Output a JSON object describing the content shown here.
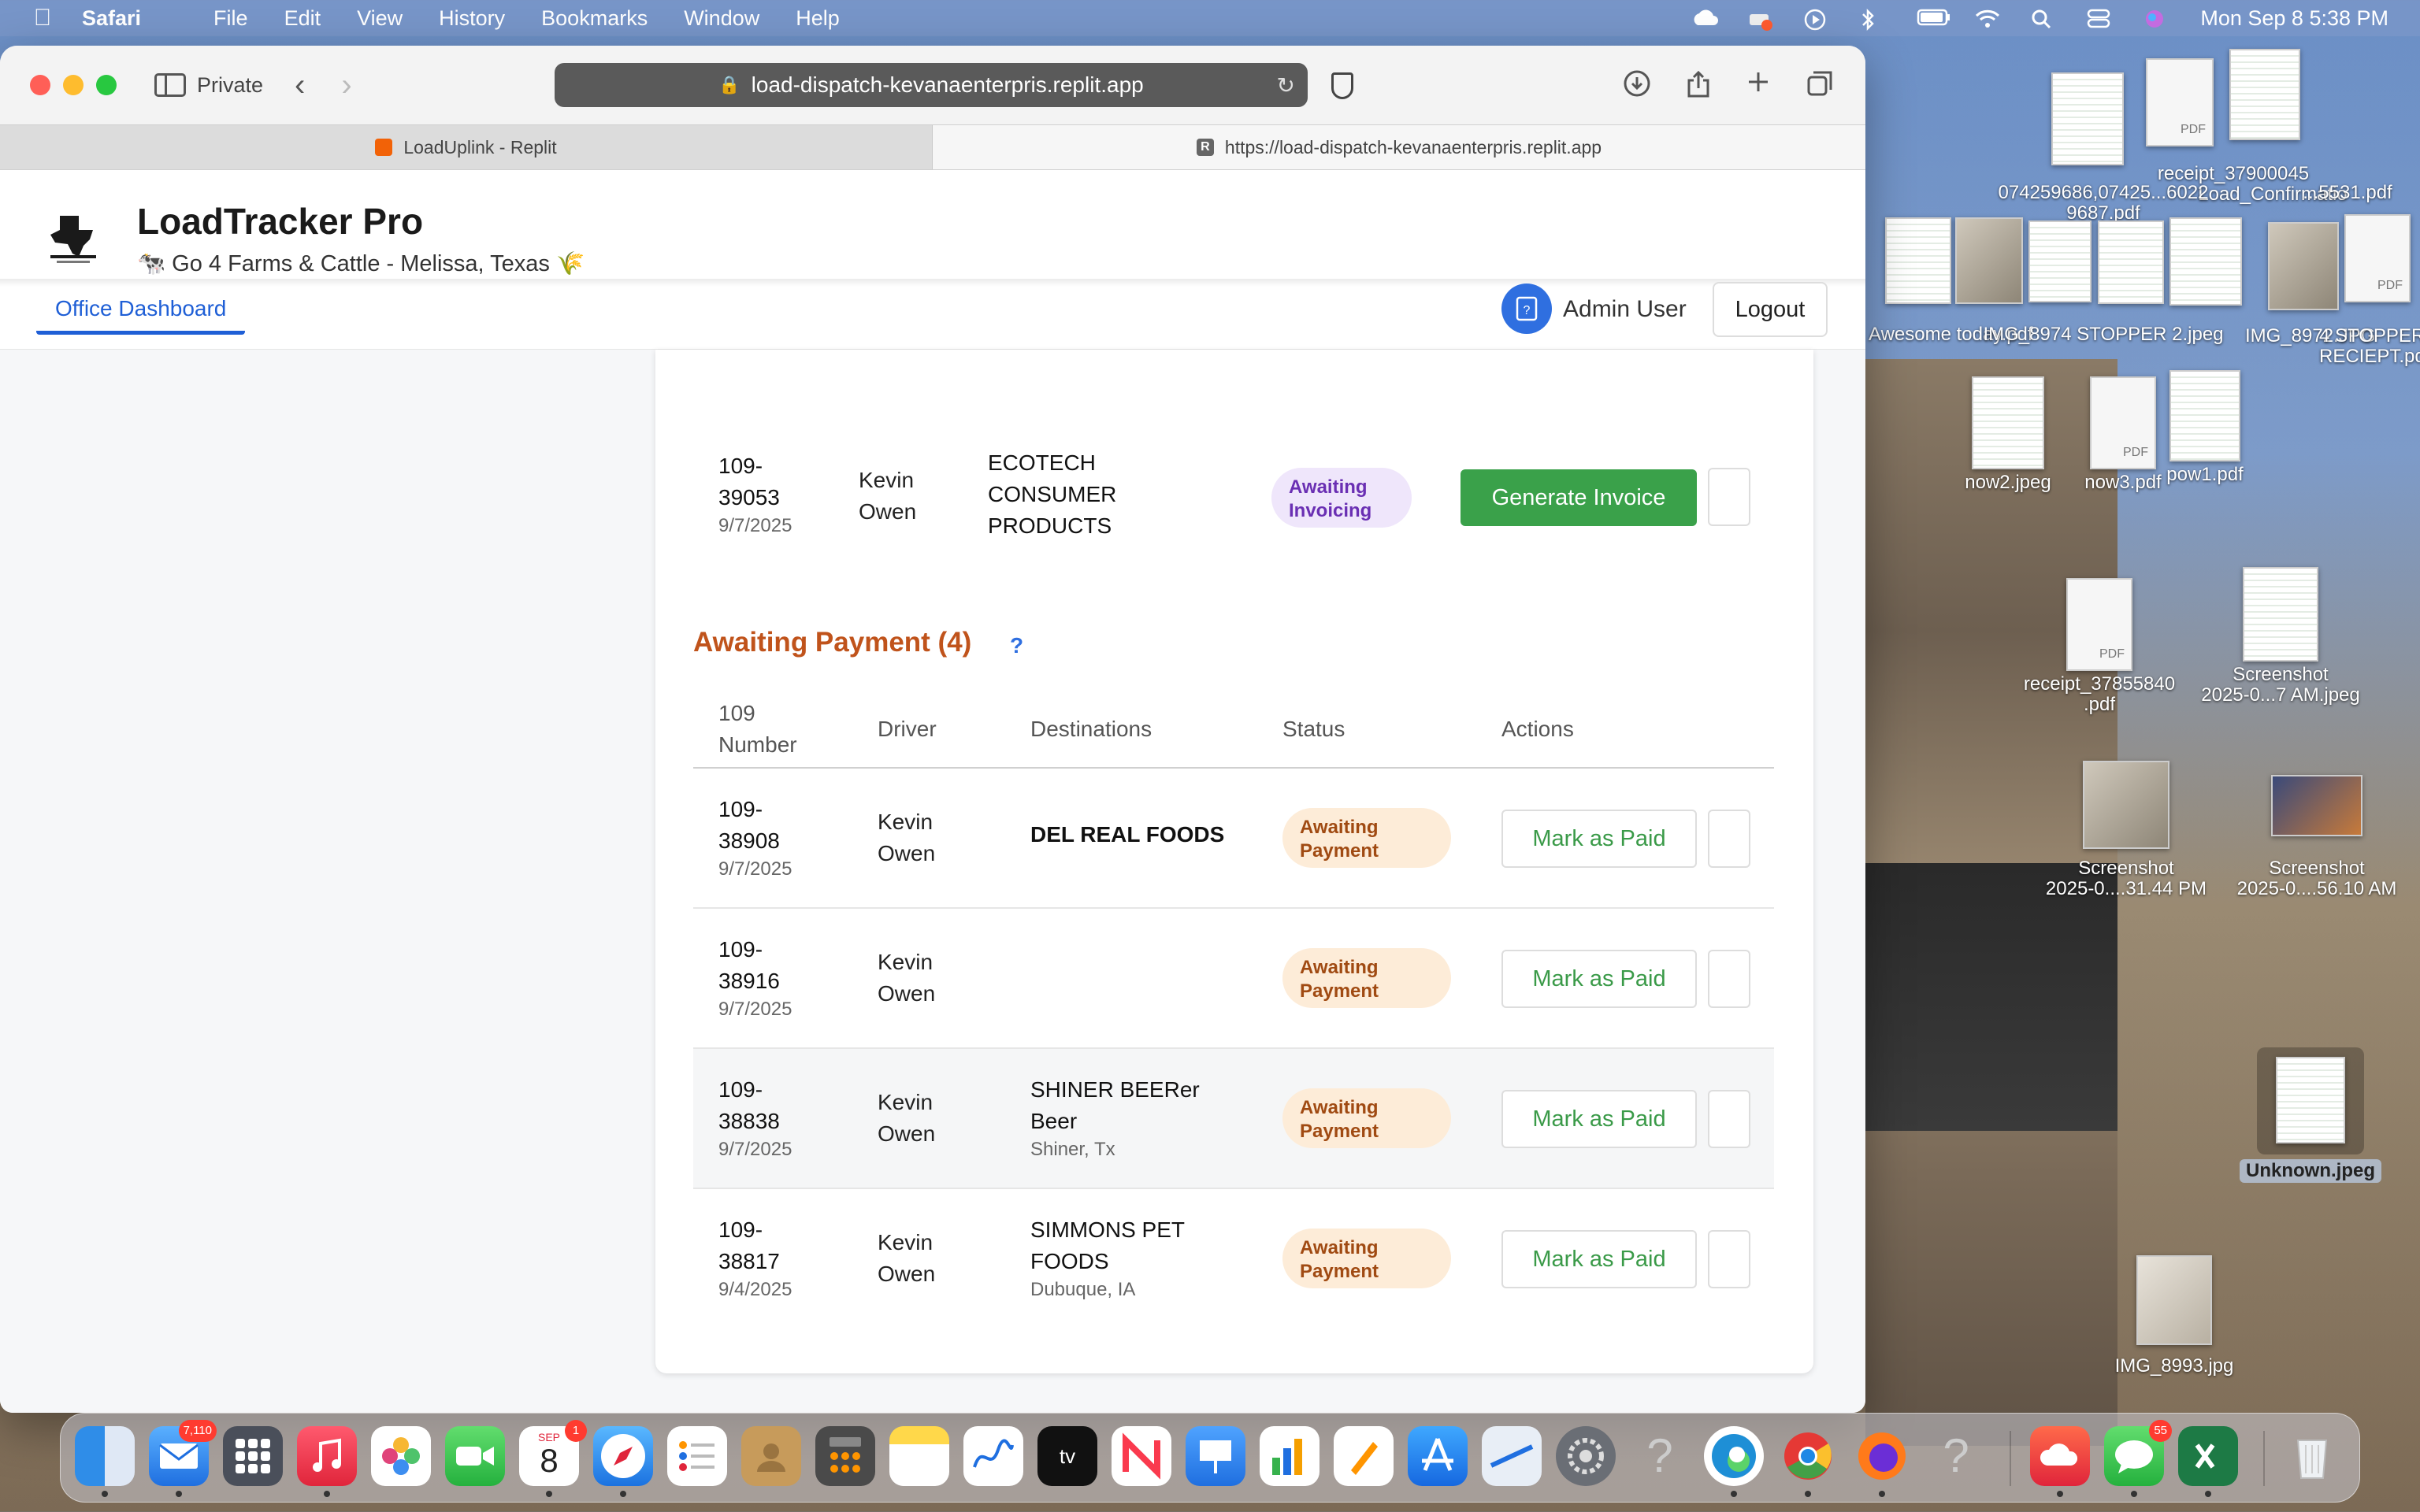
{
  "menubar": {
    "app": "Safari",
    "items": [
      "File",
      "Edit",
      "View",
      "History",
      "Bookmarks",
      "Window",
      "Help"
    ],
    "datetime": "Mon Sep 8  5:38 PM"
  },
  "browser": {
    "private_label": "Private",
    "address": "load-dispatch-kevanaenterpris.replit.app",
    "tabs": [
      {
        "label": "LoadUplink - Replit"
      },
      {
        "label": "https://load-dispatch-kevanaenterpris.replit.app"
      }
    ]
  },
  "app": {
    "title": "LoadTracker Pro",
    "subtitle": "🐄 Go 4 Farms & Cattle - Melissa, Texas 🌾",
    "nav_tab": "Office Dashboard",
    "user": "Admin User",
    "logout": "Logout"
  },
  "invoicing_row": {
    "number_line1": "109-",
    "number_line2": "39053",
    "date": "9/7/2025",
    "driver_line1": "Kevin",
    "driver_line2": "Owen",
    "dest_line1": "ECOTECH",
    "dest_line2": "CONSUMER",
    "dest_line3": "PRODUCTS",
    "status_line1": "Awaiting",
    "status_line2": "Invoicing",
    "action": "Generate Invoice"
  },
  "awaiting_payment": {
    "title": "Awaiting Payment (4)",
    "help": "?",
    "headers": {
      "number_line1": "109",
      "number_line2": "Number",
      "driver": "Driver",
      "destinations": "Destinations",
      "status": "Status",
      "actions": "Actions"
    },
    "rows": [
      {
        "n1": "109-",
        "n2": "38908",
        "date": "9/7/2025",
        "d1": "Kevin",
        "d2": "Owen",
        "dest1": "DEL REAL FOODS",
        "dest2": "",
        "loc": "",
        "s1": "Awaiting",
        "s2": "Payment",
        "action": "Mark as Paid"
      },
      {
        "n1": "109-",
        "n2": "38916",
        "date": "9/7/2025",
        "d1": "Kevin",
        "d2": "Owen",
        "dest1": "",
        "dest2": "",
        "loc": "",
        "s1": "Awaiting",
        "s2": "Payment",
        "action": "Mark as Paid"
      },
      {
        "n1": "109-",
        "n2": "38838",
        "date": "9/7/2025",
        "d1": "Kevin",
        "d2": "Owen",
        "dest1": "SHINER BEERer",
        "dest2": "Beer",
        "loc": "Shiner, Tx",
        "s1": "Awaiting",
        "s2": "Payment",
        "action": "Mark as Paid"
      },
      {
        "n1": "109-",
        "n2": "38817",
        "date": "9/4/2025",
        "d1": "Kevin",
        "d2": "Owen",
        "dest1": "SIMMONS PET",
        "dest2": "FOODS",
        "loc": "Dubuque, IA",
        "s1": "Awaiting",
        "s2": "Payment",
        "action": "Mark as Paid"
      }
    ]
  },
  "desktop": {
    "icons": [
      {
        "label1": "receipt_37900045",
        "label2": ".pdf"
      },
      {
        "label1": "Load_Confirmatio",
        "label2": "...5531.pdf"
      },
      {
        "label1": "074259686,07425...6022",
        "label2": "9687.pdf"
      },
      {
        "label1": "Awesome today.pdf",
        "label2": ""
      },
      {
        "label1": "IMG_8974 STOPPER 2.jpeg",
        "label2": ""
      },
      {
        "label1": "IMG_8972.JPG",
        "label2": ""
      },
      {
        "label1": "4 STOPPER",
        "label2": "RECIEPT.pdf"
      },
      {
        "label1": "now2.jpeg",
        "label2": ""
      },
      {
        "label1": "now3.pdf",
        "label2": ""
      },
      {
        "label1": "pow1.pdf",
        "label2": ""
      },
      {
        "label1": "receipt_37855840",
        "label2": ".pdf"
      },
      {
        "label1": "Screenshot",
        "label2": "2025-0...7 AM.jpeg"
      },
      {
        "label1": "Screenshot",
        "label2": "2025-0....31.44 PM"
      },
      {
        "label1": "Screenshot",
        "label2": "2025-0....56.10 AM"
      },
      {
        "label1": "Unknown.jpeg",
        "label2": ""
      },
      {
        "label1": "IMG_8993.jpg",
        "label2": ""
      }
    ]
  },
  "dock": {
    "mail_badge": "7,110",
    "calendar_month": "SEP",
    "calendar_day": "8",
    "calendar_badge": "1",
    "messages_badge": "55",
    "appletv_label": "tv"
  }
}
